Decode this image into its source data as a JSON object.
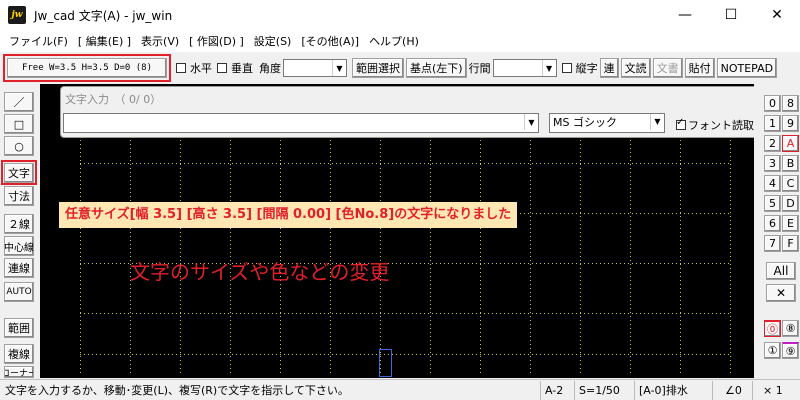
{
  "window": {
    "title": "Jw_cad 文字(A) - jw_win",
    "icon_text": "jw",
    "minimize": "—",
    "maximize": "☐",
    "close": "✕"
  },
  "menu": [
    "ファイル(F)",
    "[ 編集(E) ]",
    "表示(V)",
    "[ 作図(D) ]",
    "設定(S)",
    "[その他(A)]",
    "ヘルプ(H)"
  ],
  "toolbar": {
    "free_button": "Free  W=3.5 H=3.5 D=0 (8)",
    "horizontal": "水平",
    "vertical": "垂直",
    "angle": "角度",
    "range_select": "範囲選択",
    "base_point": "基点(左下)",
    "line_spacing": "行間",
    "vertical_text": "縦字",
    "continuous": "連",
    "read_text": "文読",
    "write_text": "文書",
    "paste": "貼付",
    "notepad": "NOTEPAD"
  },
  "left_toolbar": [
    "／",
    "□",
    "○",
    "文字",
    "寸法",
    "２線",
    "中心線",
    "連線",
    "AUTO",
    "範囲",
    "複線",
    "コーナー"
  ],
  "text_input": {
    "label": "文字入力　（ 0/  0）",
    "value": "",
    "font": "MS ゴシック",
    "font_read": "フォント読取"
  },
  "annotations": {
    "message": "任意サイズ[幅 3.5] [高さ 3.5] [間隔 0.00] [色No.8]の文字になりました",
    "heading": "文字のサイズや色などの変更"
  },
  "right_toolbar": {
    "left_column": [
      "0",
      "1",
      "2",
      "3",
      "4",
      "5",
      "6",
      "7"
    ],
    "right_column": [
      "8",
      "9",
      "A",
      "B",
      "C",
      "D",
      "E",
      "F"
    ],
    "all": "All",
    "cross": "✕",
    "bottom_left": [
      "⓪",
      "①"
    ],
    "bottom_right": [
      "⑧",
      "⑨"
    ]
  },
  "status": {
    "message": "文字を入力するか、移動･変更(L)、複写(R)で文字を指示して下さい。",
    "paper": "A-2",
    "scale": "S=1/50",
    "layer": "[A-0]排水",
    "angle": "∠0",
    "factor": "× 1"
  },
  "colors": {
    "accent_red": "#e0202a",
    "canvas_bg": "#000000",
    "grid_dot": "#c8c84a",
    "message_bg": "#ffe7b3"
  }
}
